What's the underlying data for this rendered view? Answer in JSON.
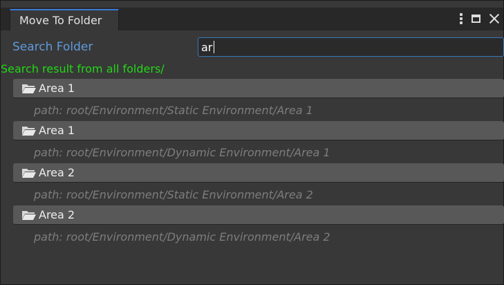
{
  "window": {
    "tab_title": "Move To Folder",
    "menu_icon": "kebab-menu-icon",
    "maximize_icon": "maximize-icon",
    "close_icon": "close-icon"
  },
  "search": {
    "label": "Search Folder",
    "value": "ar"
  },
  "results": {
    "header": "Search result from all folders/",
    "items": [
      {
        "name": "Area 1",
        "path": "path: root/Environment/Static Environment/Area 1",
        "icon": "folder-open-icon"
      },
      {
        "name": "Area 1",
        "path": "path: root/Environment/Dynamic Environment/Area 1",
        "icon": "folder-open-icon"
      },
      {
        "name": "Area 2",
        "path": "path: root/Environment/Static Environment/Area 2",
        "icon": "folder-open-icon"
      },
      {
        "name": "Area 2",
        "path": "path: root/Environment/Dynamic Environment/Area 2",
        "icon": "folder-open-icon"
      }
    ]
  },
  "colors": {
    "accent": "#3b7ad8",
    "label_blue": "#5f9bdc",
    "result_green": "#22d716",
    "path_gray": "#7d7d7d",
    "panel_bg": "#383838",
    "button_bg": "#585858"
  }
}
